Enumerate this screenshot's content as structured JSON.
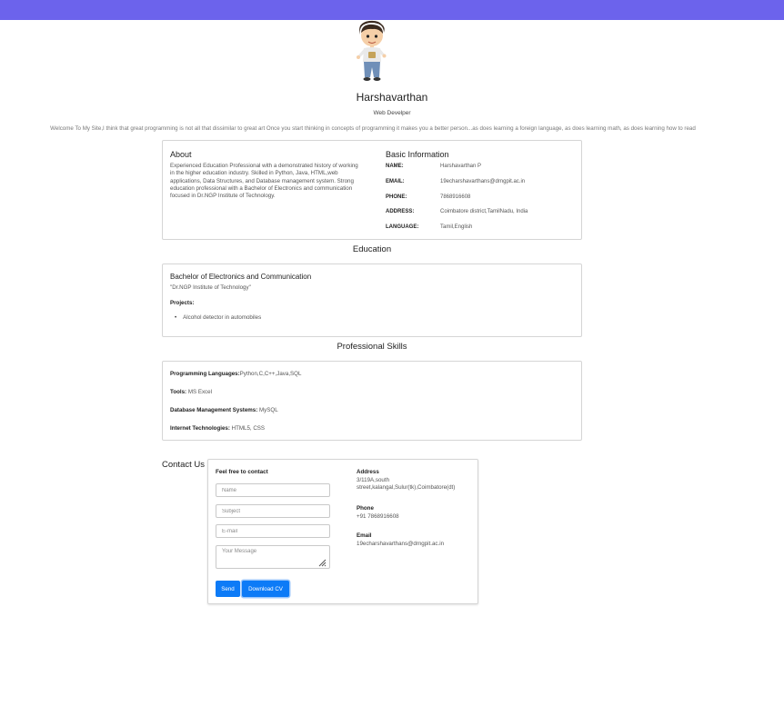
{
  "profile": {
    "name": "Harshavarthan",
    "role": "Web Develper",
    "welcome": "Welcome To My Site,I think that great programming is not all that dissimilar to great art Once you start thinking in concepts of programming it makes you a better person...as does learning a foreign language, as does learning math, as does learning how to read"
  },
  "about": {
    "title": "About",
    "text": "Experienced Education Professional with a demonstrated history of working in the higher education industry. Skilled in Python, Java, HTML,web applications, Data Structures, and Database management system. Strong education professional with a Bachelor of Electronics and communication focused in Dr.NGP Institute of Technology."
  },
  "basic_info": {
    "title": "Basic Information",
    "rows": [
      {
        "label": "NAME:",
        "value": "Harshavarthan P"
      },
      {
        "label": "EMAIL:",
        "value": "19echarshavarthans@drngpit.ac.in"
      },
      {
        "label": "PHONE:",
        "value": "7868916608"
      },
      {
        "label": "ADDRESS:",
        "value": "Coimbatore district,TamilNadu, India"
      },
      {
        "label": "LANGUAGE:",
        "value": "Tamil,English"
      }
    ]
  },
  "education": {
    "section_title": "Education",
    "degree": "Bachelor of Electronics and Communication",
    "institute": "\"Dr.NGP Institute of Technology\"",
    "projects_label": "Projects:",
    "projects": [
      "Alcohol detector in automobiles"
    ]
  },
  "skills": {
    "section_title": "Professional Skills",
    "rows": [
      {
        "label": "Programming Languages:",
        "value": "Python,C,C++,Java,SQL"
      },
      {
        "label": "Tools:",
        "value": " MS Excel"
      },
      {
        "label": "Database Management Systems:",
        "value": " MySQL"
      },
      {
        "label": "Internet Technologies:",
        "value": " HTML5, CSS"
      }
    ]
  },
  "contact": {
    "heading": "Contact Us",
    "form_label": "Feel free to contact",
    "name_placeholder": "Name",
    "subject_placeholder": "Subject",
    "email_placeholder": "E-mail",
    "message_placeholder": "Your Message",
    "send_label": "Send",
    "download_label": "Download CV",
    "address_label": "Address",
    "address_value": "3/119A,south street,kalangal,Sulur(tk),Coimbatore(dt)",
    "phone_label": "Phone",
    "phone_value": "+91 7868916608",
    "email_label": "Email",
    "email_value": "19echarshavarthans@drngpit.ac.in"
  },
  "colors": {
    "topbar": "#6c63ec",
    "button": "#0d7bf7"
  }
}
